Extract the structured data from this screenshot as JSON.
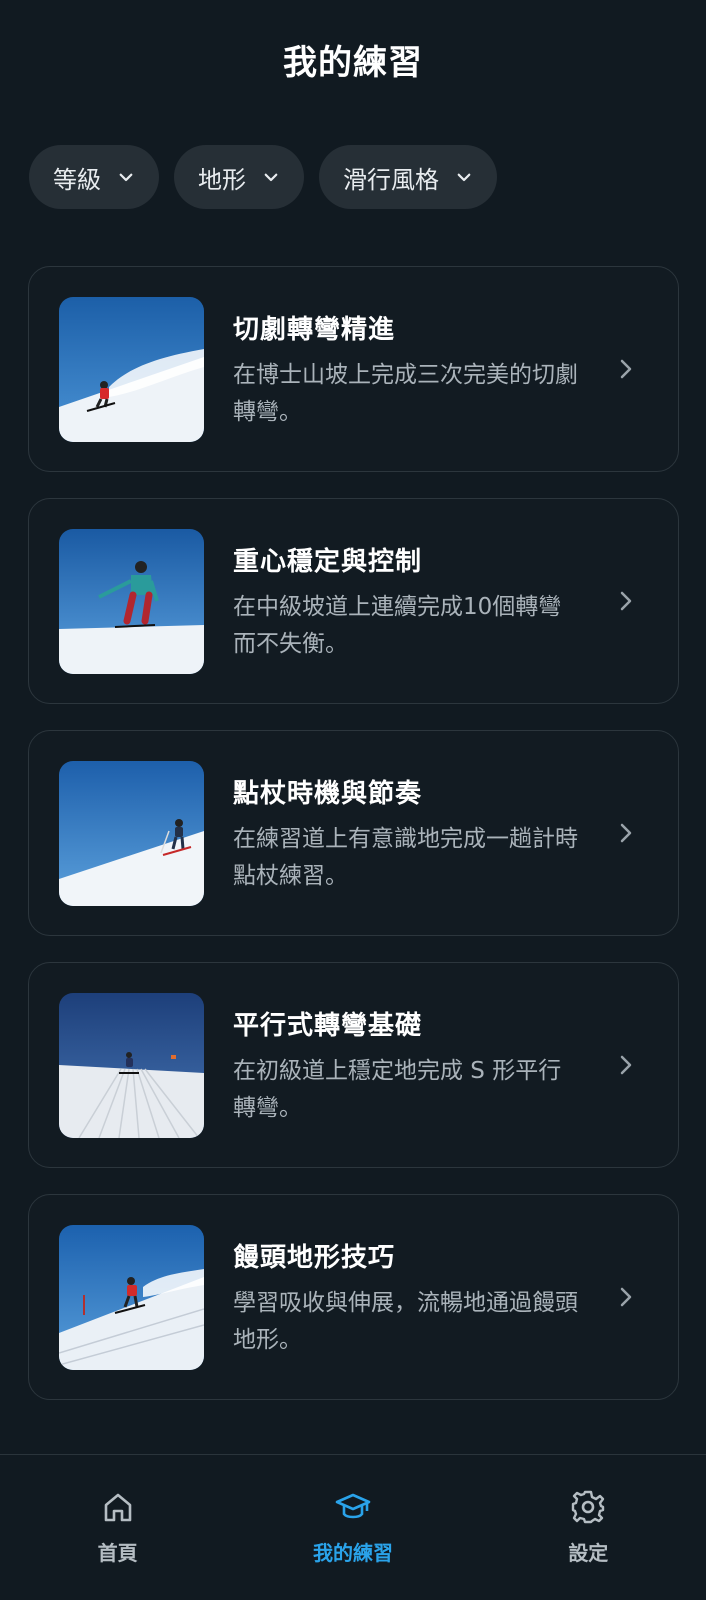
{
  "header": {
    "title": "我的練習"
  },
  "filters": [
    {
      "label": "等級"
    },
    {
      "label": "地形"
    },
    {
      "label": "滑行風格"
    }
  ],
  "drills": [
    {
      "title": "切劇轉彎精進",
      "description": "在博士山坡上完成三次完美的切劇轉彎。"
    },
    {
      "title": "重心穩定與控制",
      "description": "在中級坡道上連續完成10個轉彎而不失衡。"
    },
    {
      "title": "點杖時機與節奏",
      "description": "在練習道上有意識地完成一趟計時點杖練習。"
    },
    {
      "title": "平行式轉彎基礎",
      "description": "在初級道上穩定地完成 S 形平行轉彎。"
    },
    {
      "title": "饅頭地形技巧",
      "description": "學習吸收與伸展，流暢地通過饅頭地形。"
    }
  ],
  "tabs": [
    {
      "label": "首頁",
      "icon": "home-icon"
    },
    {
      "label": "我的練習",
      "icon": "graduation-cap-icon"
    },
    {
      "label": "設定",
      "icon": "gear-icon"
    }
  ],
  "colors": {
    "accent": "#2aa3ea",
    "background": "#111a21",
    "card_border": "#2c363d"
  }
}
